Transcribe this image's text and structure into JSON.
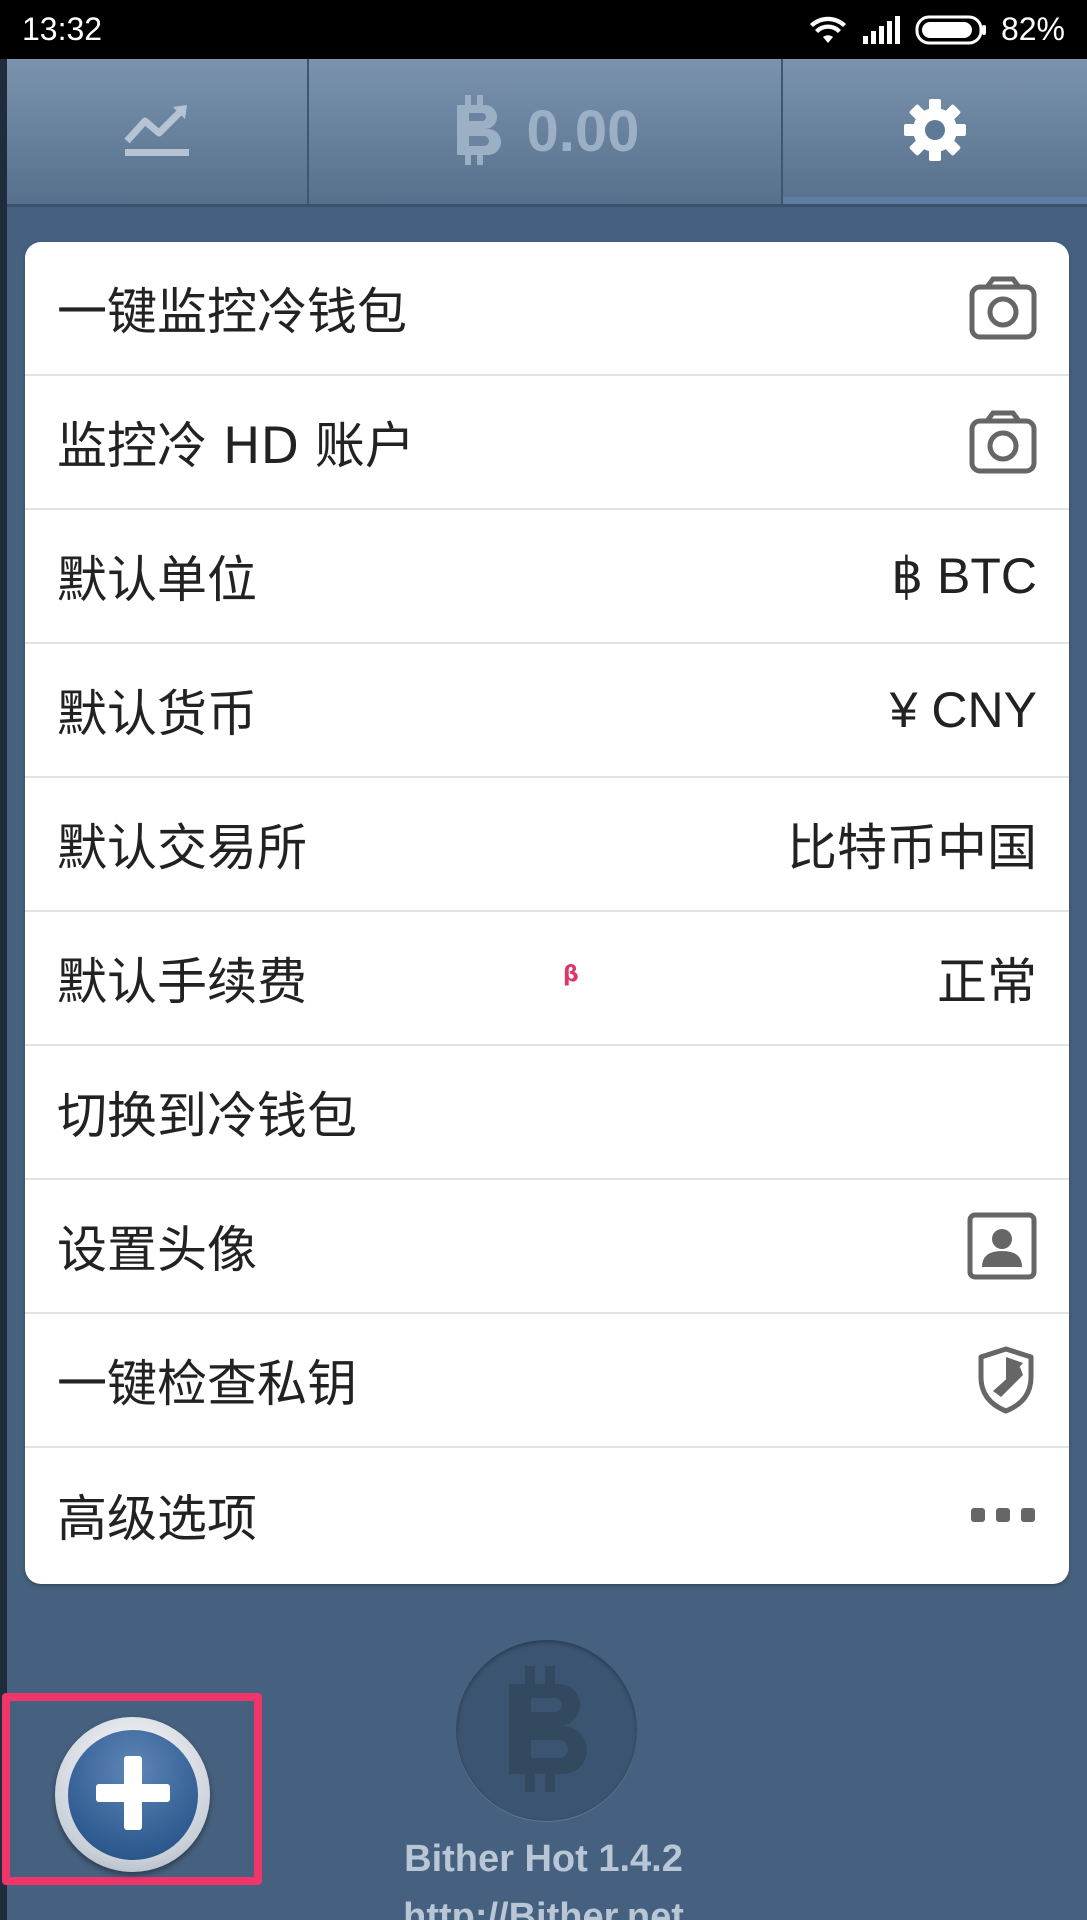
{
  "status_bar": {
    "time": "13:32",
    "battery": "82%"
  },
  "tabs": {
    "balance_amount": "0.00"
  },
  "settings": {
    "items": [
      {
        "label": "一键监控冷钱包",
        "icon": "camera-icon"
      },
      {
        "label": "监控冷 HD 账户",
        "icon": "camera-icon"
      },
      {
        "label": "默认单位",
        "value": "฿ BTC"
      },
      {
        "label": "默认货币",
        "value": "¥ CNY"
      },
      {
        "label": "默认交易所",
        "value": "比特币中国"
      },
      {
        "label": "默认手续费",
        "value": "正常",
        "badge": "β"
      },
      {
        "label": "切换到冷钱包"
      },
      {
        "label": "设置头像",
        "icon": "avatar-icon"
      },
      {
        "label": "一键检查私钥",
        "icon": "shield-icon"
      },
      {
        "label": "高级选项",
        "icon": "more-icon"
      }
    ]
  },
  "footer": {
    "version": "Bither Hot  1.4.2",
    "url": "http://Bither.net"
  },
  "colors": {
    "background": "#46617f",
    "highlight": "#f0356b",
    "card": "#ffffff"
  }
}
